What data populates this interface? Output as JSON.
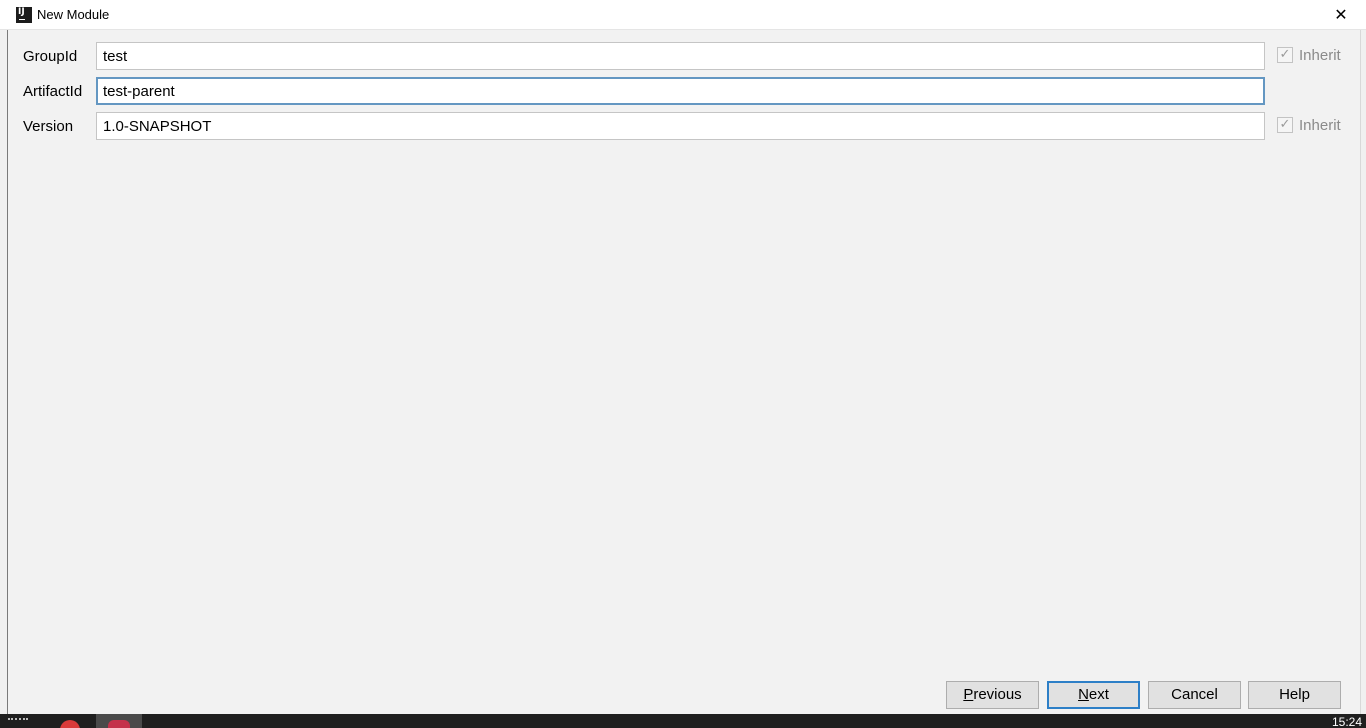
{
  "window": {
    "title": "New Module",
    "app_icon_glyph": "IJ"
  },
  "fields": [
    {
      "label": "GroupId",
      "value": "test",
      "inherit": {
        "label": "Inherit",
        "checked": true
      }
    },
    {
      "label": "ArtifactId",
      "value": "test-parent"
    },
    {
      "label": "Version",
      "value": "1.0-SNAPSHOT",
      "inherit": {
        "label": "Inherit",
        "checked": true
      }
    }
  ],
  "buttons": {
    "previous": {
      "mnemonic": "P",
      "rest": "revious"
    },
    "next": {
      "mnemonic": "N",
      "rest": "ext"
    },
    "cancel": "Cancel",
    "help": "Help"
  },
  "taskbar": {
    "clock": "15:24"
  },
  "icons": {
    "close": "close-icon",
    "check": "check-icon",
    "app": "intellij-icon"
  },
  "colors": {
    "focus_border": "#6497c2",
    "default_button_border": "#2d7fc7",
    "dialog_bg": "#f2f2f2"
  }
}
